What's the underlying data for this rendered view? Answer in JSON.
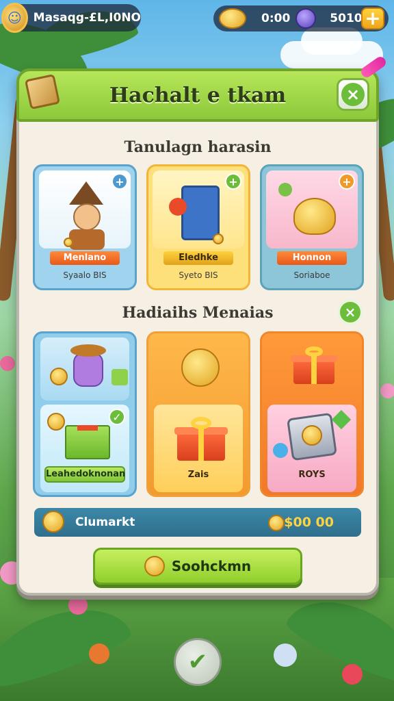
{
  "hud": {
    "player_name": "Masaqg-£L,I0NO",
    "timer": "0:00",
    "gems": "5010",
    "add_label": "+"
  },
  "panel": {
    "title": "Hachalt e tkam",
    "close_label": "×"
  },
  "section1": {
    "title": "Tanulagn harasin",
    "cards": [
      {
        "tag": "Menlano",
        "sub": "Syaalo BIS",
        "badge": "+"
      },
      {
        "tag": "Eledhke",
        "sub": "Syeto BIS",
        "badge": "+"
      },
      {
        "tag": "Honnon",
        "sub": "Soriaboe",
        "badge": "+"
      }
    ]
  },
  "section2": {
    "title": "Hadiaihs Menaias",
    "close_label": "×",
    "cards": [
      {
        "label": "Leahedoknonan",
        "badge": "✓"
      },
      {
        "label": "Zais"
      },
      {
        "label": "ROYS"
      }
    ]
  },
  "currency_bar": {
    "label": "Clumarkt",
    "price": "$00 00"
  },
  "main_button": {
    "label": "Soohckmn"
  },
  "bottom_button": {
    "label": "✔"
  },
  "colors": {
    "header_green": "#8cc93a",
    "accent_orange": "#e8591b",
    "bar_blue": "#2f6f8c",
    "gold": "#ffd23f"
  }
}
